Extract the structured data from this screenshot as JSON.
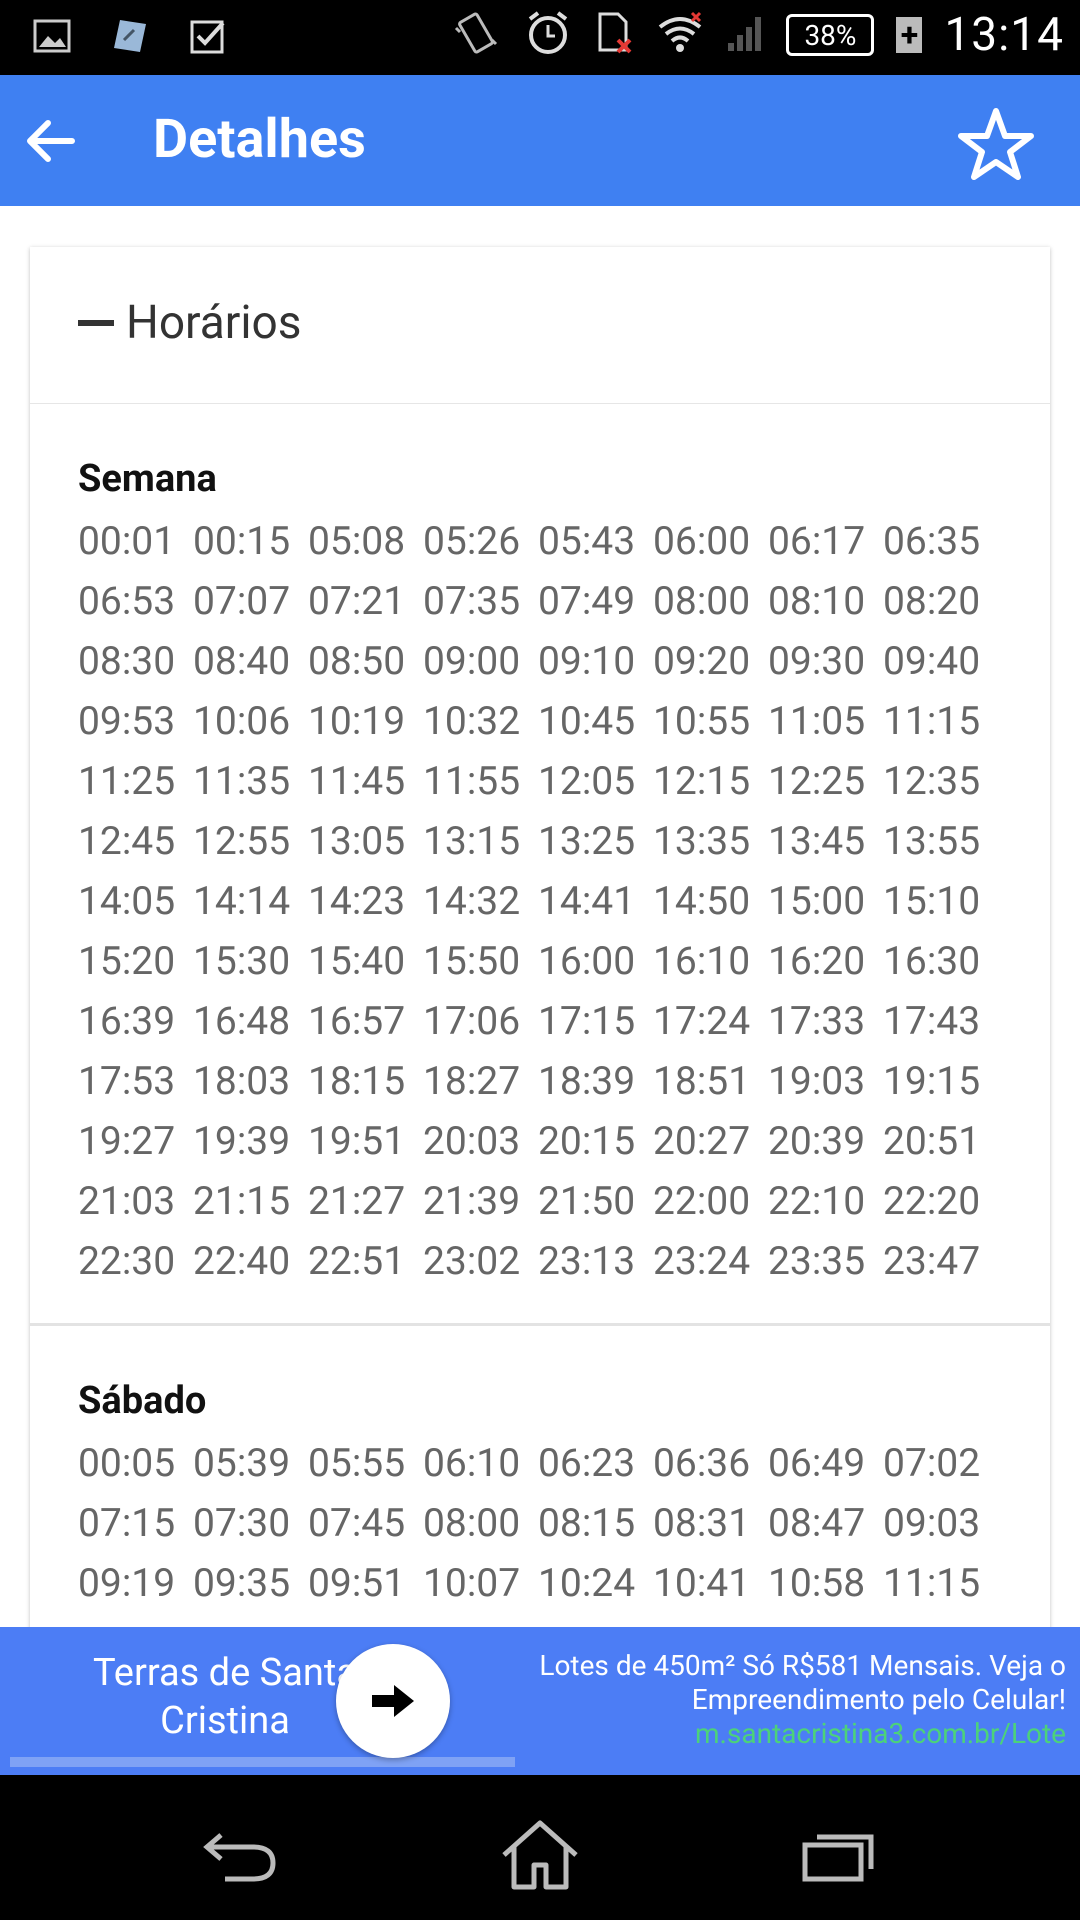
{
  "status_bar": {
    "time": "13:14",
    "battery": "38%",
    "battery_plus": "+",
    "icons_left": [
      "gallery-icon",
      "maps-icon",
      "checkbox-icon"
    ],
    "icons_right": [
      "vibrate-icon",
      "alarm-icon",
      "sd-card-error-icon",
      "wifi-icon",
      "signal-icon"
    ]
  },
  "app_bar": {
    "title": "Detalhes",
    "back_icon": "arrow-left-icon",
    "favorite_icon": "star-outline-icon"
  },
  "card": {
    "header": "Horários",
    "sections": [
      {
        "title": "Semana",
        "times": [
          "00:01",
          "00:15",
          "05:08",
          "05:26",
          "05:43",
          "06:00",
          "06:17",
          "06:35",
          "06:53",
          "07:07",
          "07:21",
          "07:35",
          "07:49",
          "08:00",
          "08:10",
          "08:20",
          "08:30",
          "08:40",
          "08:50",
          "09:00",
          "09:10",
          "09:20",
          "09:30",
          "09:40",
          "09:53",
          "10:06",
          "10:19",
          "10:32",
          "10:45",
          "10:55",
          "11:05",
          "11:15",
          "11:25",
          "11:35",
          "11:45",
          "11:55",
          "12:05",
          "12:15",
          "12:25",
          "12:35",
          "12:45",
          "12:55",
          "13:05",
          "13:15",
          "13:25",
          "13:35",
          "13:45",
          "13:55",
          "14:05",
          "14:14",
          "14:23",
          "14:32",
          "14:41",
          "14:50",
          "15:00",
          "15:10",
          "15:20",
          "15:30",
          "15:40",
          "15:50",
          "16:00",
          "16:10",
          "16:20",
          "16:30",
          "16:39",
          "16:48",
          "16:57",
          "17:06",
          "17:15",
          "17:24",
          "17:33",
          "17:43",
          "17:53",
          "18:03",
          "18:15",
          "18:27",
          "18:39",
          "18:51",
          "19:03",
          "19:15",
          "19:27",
          "19:39",
          "19:51",
          "20:03",
          "20:15",
          "20:27",
          "20:39",
          "20:51",
          "21:03",
          "21:15",
          "21:27",
          "21:39",
          "21:50",
          "22:00",
          "22:10",
          "22:20",
          "22:30",
          "22:40",
          "22:51",
          "23:02",
          "23:13",
          "23:24",
          "23:35",
          "23:47"
        ]
      },
      {
        "title": "Sábado",
        "times": [
          "00:05",
          "05:39",
          "05:55",
          "06:10",
          "06:23",
          "06:36",
          "06:49",
          "07:02",
          "07:15",
          "07:30",
          "07:45",
          "08:00",
          "08:15",
          "08:31",
          "08:47",
          "09:03",
          "09:19",
          "09:35",
          "09:51",
          "10:07",
          "10:24",
          "10:41",
          "10:58",
          "11:15"
        ]
      }
    ]
  },
  "ad": {
    "left_line1": "Terras de Santa",
    "left_line2": "Cristina",
    "button_icon": "arrow-right-icon",
    "text_line1": "Lotes de 450m² Só R$581 Mensais. Veja o",
    "text_line2": "Empreendimento pelo Celular!",
    "url": "m.santacristina3.com.br/Lote"
  },
  "nav_bar": {
    "icons": [
      "back-icon",
      "home-icon",
      "recents-icon"
    ]
  }
}
